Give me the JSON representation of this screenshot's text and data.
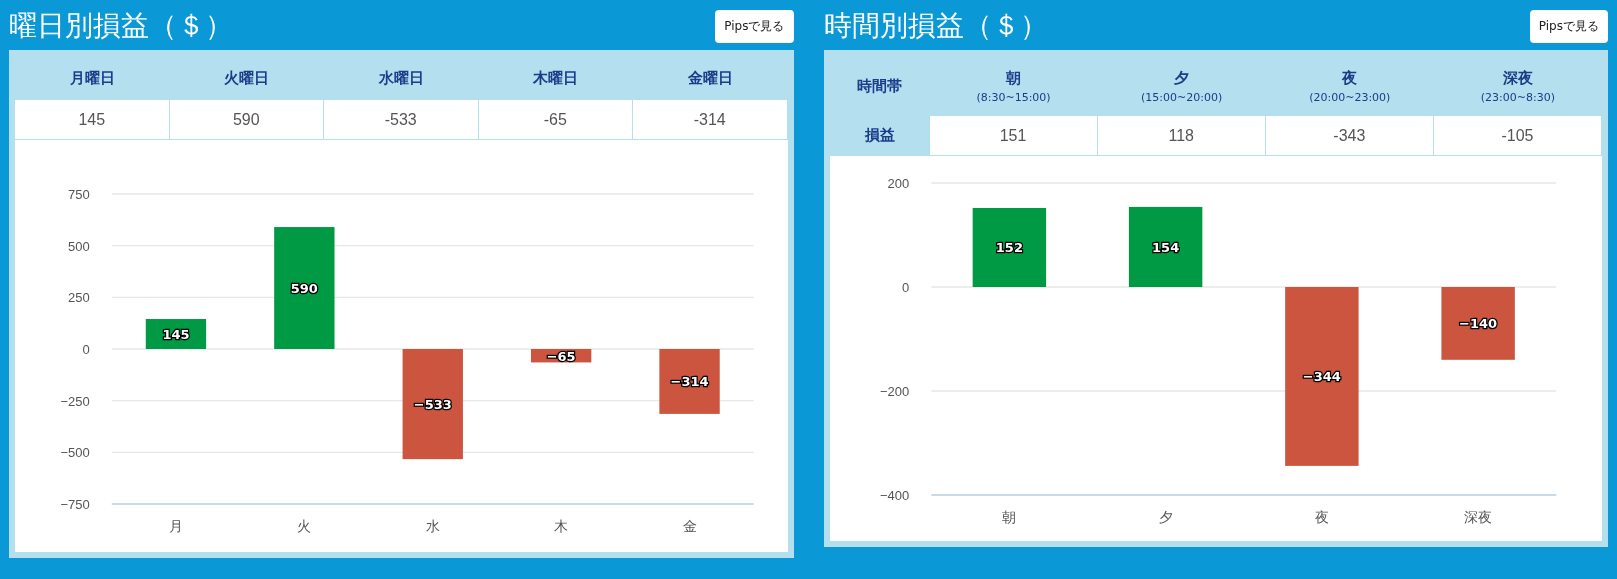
{
  "panels": [
    {
      "title": "曜日別損益（＄）",
      "button": "Pipsで見る",
      "table": {
        "columns": [
          {
            "label": "月曜日"
          },
          {
            "label": "火曜日"
          },
          {
            "label": "水曜日"
          },
          {
            "label": "木曜日"
          },
          {
            "label": "金曜日"
          }
        ],
        "values": [
          "145",
          "590",
          "-533",
          "-65",
          "-314"
        ]
      },
      "chart_data": {
        "type": "bar",
        "categories": [
          "月",
          "火",
          "水",
          "木",
          "金"
        ],
        "series": [
          {
            "color": "#009944",
            "values": [
              145,
              590,
              null,
              null,
              null
            ]
          },
          {
            "color": "#cc5540",
            "values": [
              null,
              null,
              -533,
              -65,
              -314
            ]
          }
        ],
        "stacked": true,
        "grid": true,
        "ylim": [
          -750,
          750
        ],
        "yticks": [
          {
            "value": -750,
            "label": "−750"
          },
          {
            "value": -500,
            "label": "−500"
          },
          {
            "value": -250,
            "label": "−250"
          },
          0,
          250,
          500,
          750
        ],
        "value_labels": [
          "145",
          "590",
          "−533",
          "−65",
          "−314"
        ]
      }
    },
    {
      "title": "時間別損益（＄）",
      "button": "Pipsで見る",
      "table": {
        "row_headers": [
          "時間帯",
          "損益"
        ],
        "columns": [
          {
            "label": "朝",
            "range": "(8:30~15:00)"
          },
          {
            "label": "夕",
            "range": "(15:00~20:00)"
          },
          {
            "label": "夜",
            "range": "(20:00~23:00)"
          },
          {
            "label": "深夜",
            "range": "(23:00~8:30)"
          }
        ],
        "values": [
          "151",
          "118",
          "-343",
          "-105"
        ]
      },
      "chart_data": {
        "type": "bar",
        "categories": [
          "朝",
          "夕",
          "夜",
          "深夜"
        ],
        "series": [
          {
            "color": "#009944",
            "values": [
              152,
              154,
              null,
              null
            ]
          },
          {
            "color": "#cc5540",
            "values": [
              null,
              null,
              -344,
              -140
            ]
          }
        ],
        "stacked": true,
        "grid": true,
        "ylim": [
          -400,
          200
        ],
        "yticks": [
          {
            "value": -400,
            "label": "−400"
          },
          {
            "value": -200,
            "label": "−200"
          },
          0,
          200
        ],
        "value_labels": [
          "152",
          "154",
          "−344",
          "−140"
        ]
      }
    }
  ]
}
